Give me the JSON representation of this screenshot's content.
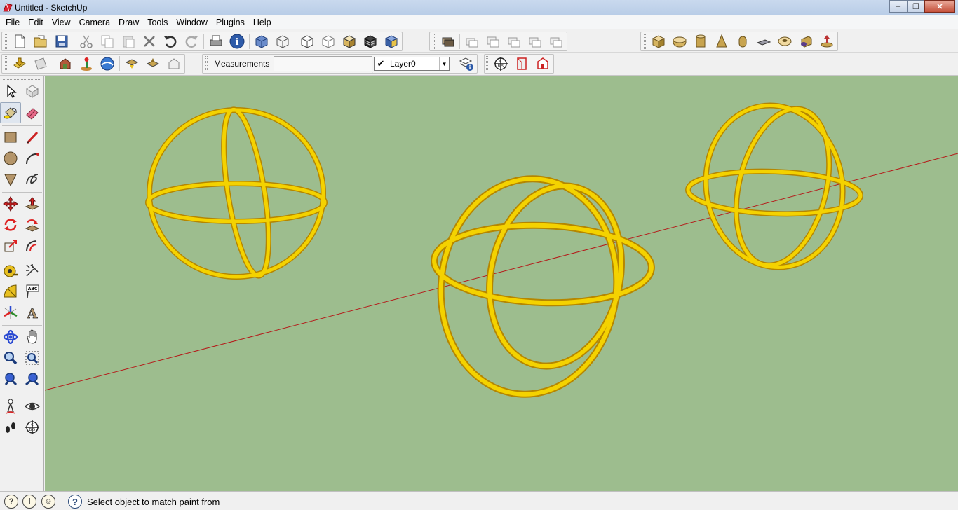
{
  "window": {
    "title": "Untitled - SketchUp"
  },
  "menu": [
    "File",
    "Edit",
    "View",
    "Camera",
    "Draw",
    "Tools",
    "Window",
    "Plugins",
    "Help"
  ],
  "toolbar": {
    "measurements_label": "Measurements",
    "measurements_value": "",
    "layer_selected": "Layer0"
  },
  "status": {
    "text": "Select object to match paint from"
  },
  "colors": {
    "viewport_bg": "#9dbd8e",
    "ring": "#f4d200",
    "ring_shade": "#c79b00",
    "axis_red": "#b51a1a",
    "accent_blue": "#3a61a6"
  },
  "icons": {
    "standard": [
      "new-icon",
      "open-icon",
      "save-icon",
      "cut-icon",
      "copy-icon",
      "paste-icon",
      "erase-icon",
      "undo-icon",
      "redo-icon",
      "print-icon",
      "model-info-icon"
    ],
    "styles": [
      "xray-icon",
      "wireframe-icon",
      "hidden-line-icon",
      "shaded-icon",
      "shaded-texture-icon",
      "monochrome-icon",
      "back-edges-icon"
    ],
    "views": [
      "iso-view-icon",
      "top-view-icon",
      "front-view-icon",
      "right-view-icon",
      "back-view-icon",
      "left-view-icon"
    ],
    "shapes": [
      "box-icon",
      "sphere-icon",
      "cylinder-icon",
      "cone-icon",
      "tube-icon",
      "plate-icon",
      "torus-icon",
      "helix-icon",
      "shape-extra-icon"
    ],
    "google": [
      "get-photo-texture-icon",
      "preview-google-earth-icon",
      "add-building-icon",
      "add-location-icon",
      "toggle-terrain-icon",
      "get-models-icon",
      "share-model-icon",
      "share-component-icon"
    ],
    "sections": [
      "section-plane-icon",
      "display-section-planes-icon",
      "display-section-cuts-icon"
    ]
  }
}
